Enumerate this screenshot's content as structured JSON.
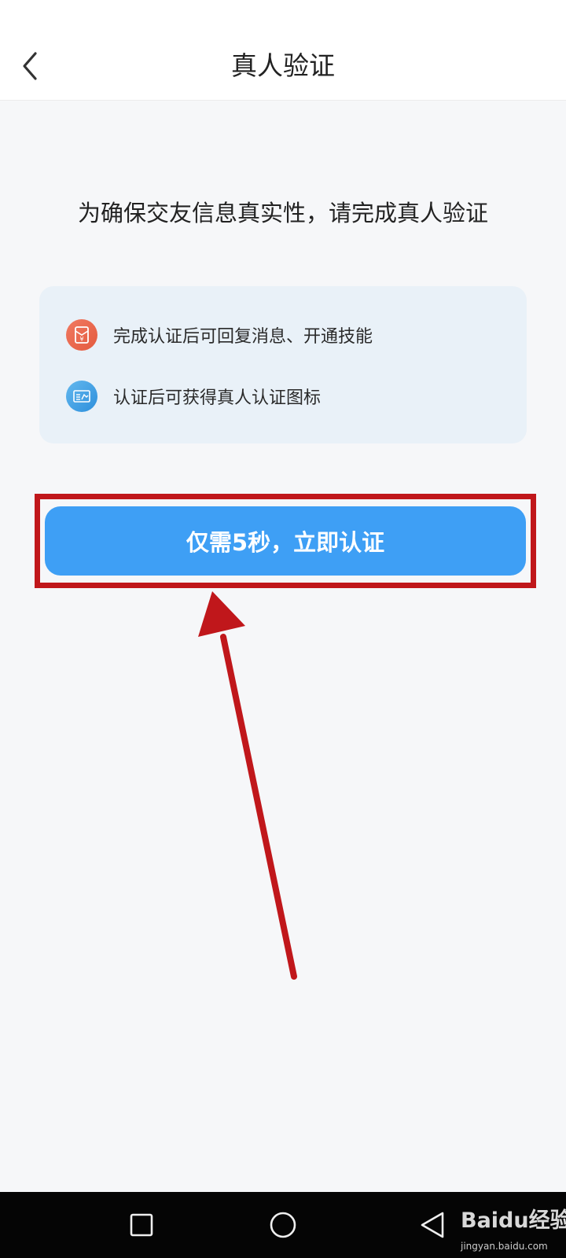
{
  "header": {
    "title": "真人验证"
  },
  "subtitle": "为确保交友信息真实性，请完成真人验证",
  "benefits": [
    {
      "icon": "red-envelope-icon",
      "text": "完成认证后可回复消息、开通技能",
      "color": "#e8604a"
    },
    {
      "icon": "id-card-icon",
      "text": "认证后可获得真人认证图标",
      "color": "#3a9be4"
    }
  ],
  "cta": {
    "label": "仅需5秒，立即认证",
    "color": "#3e9ff5"
  },
  "annotation": {
    "color": "#c0171b"
  },
  "watermark": {
    "brand": "Baidu经验",
    "domain": "jingyan.baidu.com"
  }
}
